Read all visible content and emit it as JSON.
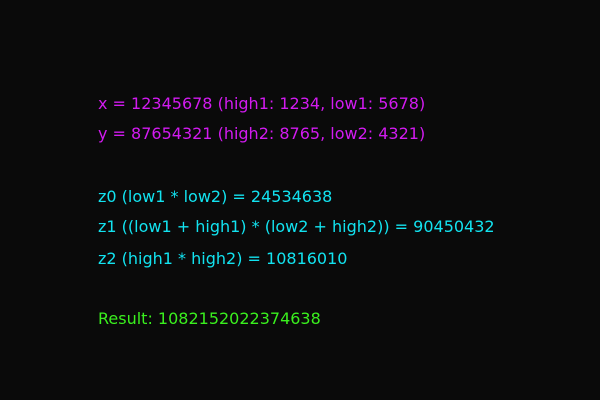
{
  "inputs": {
    "x_line": "x = 12345678 (high1: 1234, low1: 5678)",
    "y_line": "y = 87654321 (high2: 8765, low2: 4321)"
  },
  "steps": {
    "z0_line": "z0 (low1 * low2) = 24534638",
    "z1_line": "z1 ((low1 + high1) * (low2 + high2)) = 90450432",
    "z2_line": "z2 (high1 * high2) = 10816010"
  },
  "result": {
    "line": "Result: 1082152022374638"
  },
  "colors": {
    "background": "#0a0a0a",
    "inputs": "#d21bf0",
    "steps": "#12e3f0",
    "result": "#3af01e"
  }
}
